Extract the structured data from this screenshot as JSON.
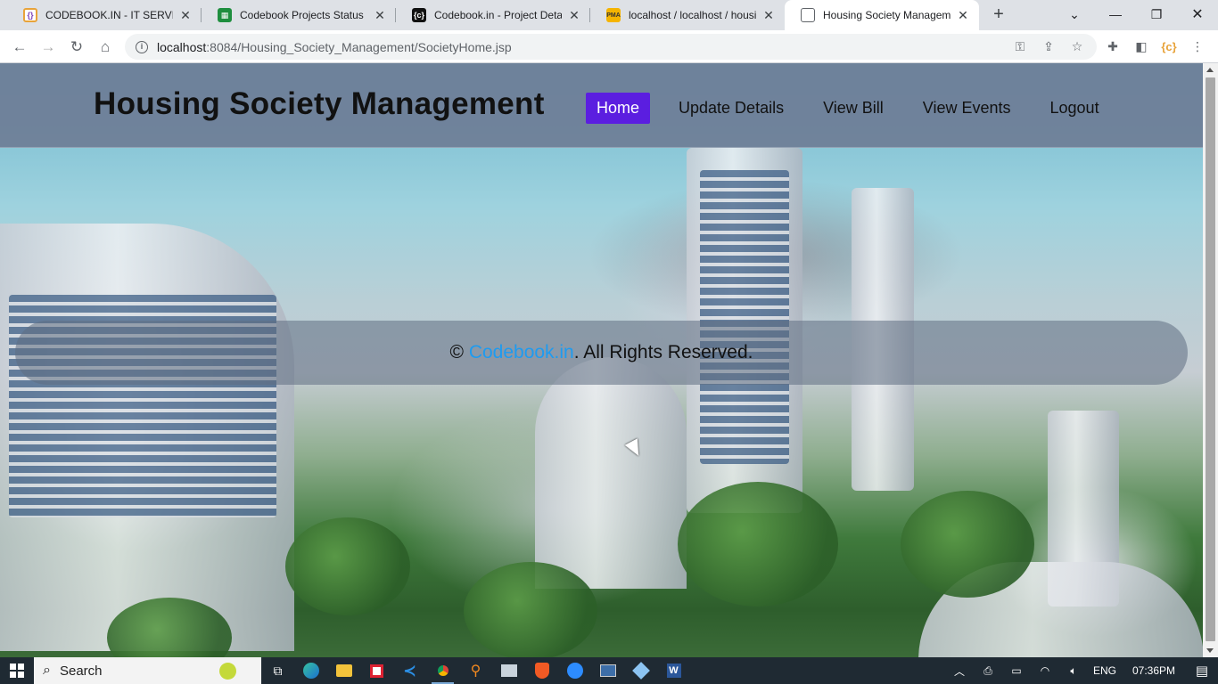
{
  "browser": {
    "tabs": [
      {
        "title": "CODEBOOK.IN - IT SERVICES",
        "favicon": "codebook-logo-icon",
        "active": false
      },
      {
        "title": "Codebook Projects Status Re",
        "favicon": "google-sheets-icon",
        "active": false
      },
      {
        "title": "Codebook.in - Project Details",
        "favicon": "codebook-dark-icon",
        "active": false
      },
      {
        "title": "localhost / localhost / housin",
        "favicon": "phpmyadmin-icon",
        "active": false
      },
      {
        "title": "Housing Society Managemen",
        "favicon": "page-icon",
        "active": true
      }
    ],
    "url_host": "localhost",
    "url_path": ":8084/Housing_Society_Management/SocietyHome.jsp"
  },
  "page": {
    "brand": "Housing Society Management",
    "nav": [
      {
        "label": "Home",
        "active": true
      },
      {
        "label": "Update Details",
        "active": false
      },
      {
        "label": "View Bill",
        "active": false
      },
      {
        "label": "View Events",
        "active": false
      },
      {
        "label": "Logout",
        "active": false
      }
    ],
    "footer": {
      "prefix": "© ",
      "link": "Codebook.in",
      "suffix": ". All Rights Reserved."
    }
  },
  "taskbar": {
    "search_label": "Search",
    "language": "ENG",
    "time": "07:36PM"
  },
  "colors": {
    "nav_active_bg": "#5b1ee0",
    "footer_link": "#1e9bf0",
    "header_bg": "#6e7d96"
  }
}
